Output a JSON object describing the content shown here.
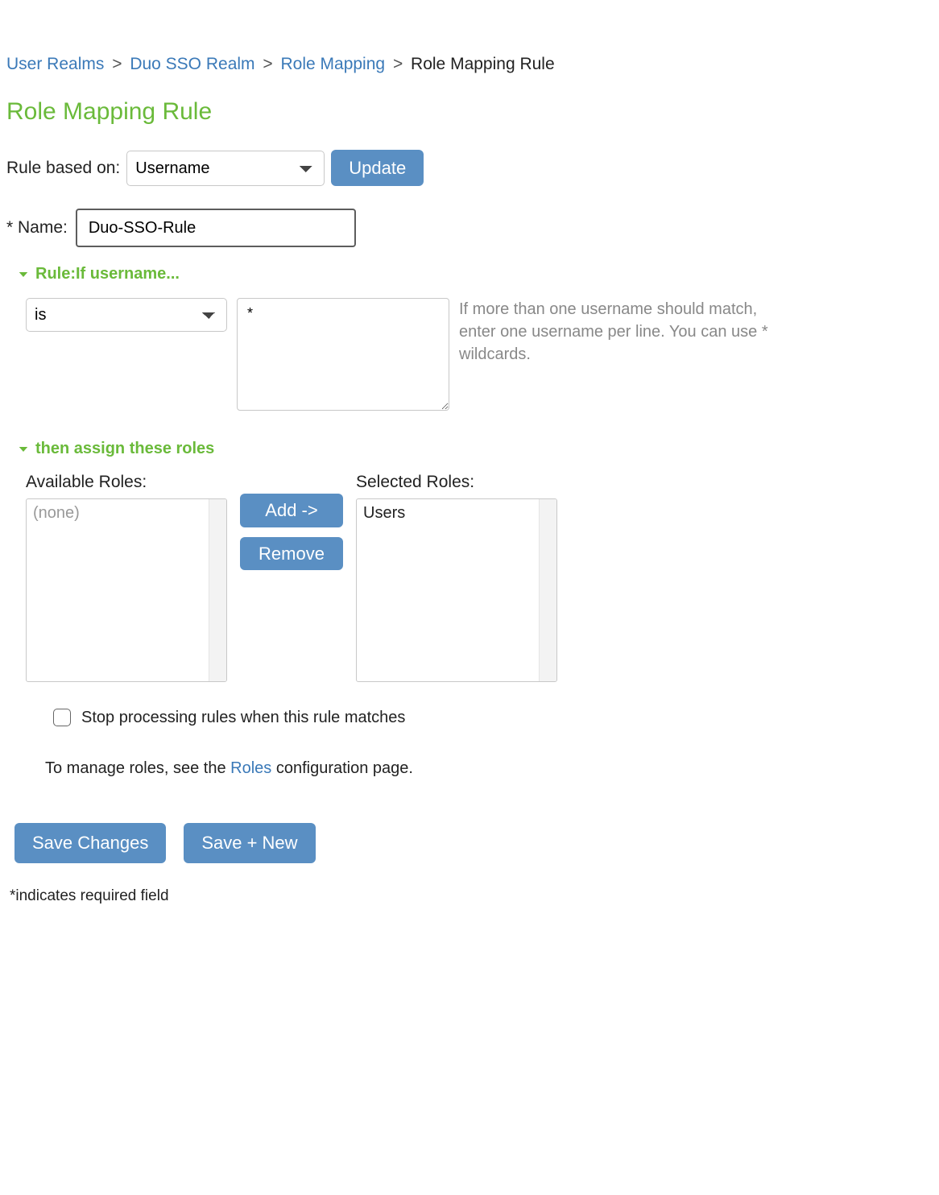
{
  "breadcrumb": {
    "items": [
      {
        "label": "User Realms",
        "link": true
      },
      {
        "label": "Duo SSO Realm",
        "link": true
      },
      {
        "label": "Role Mapping",
        "link": true
      },
      {
        "label": "Role Mapping Rule",
        "link": false
      }
    ],
    "sep": ">"
  },
  "page_title": "Role Mapping Rule",
  "rule_basis": {
    "label": "Rule based on:",
    "selected": "Username",
    "update_button": "Update"
  },
  "name_field": {
    "label": "* Name:",
    "value": "Duo-SSO-Rule"
  },
  "sections": {
    "rule": {
      "header": "Rule:If username...",
      "condition_selected": "is",
      "value": "*",
      "hint": "If more than one username should match, enter one username per line. You can use * wildcards."
    },
    "assign": {
      "header": "then assign these roles",
      "available_label": "Available Roles:",
      "selected_label": "Selected Roles:",
      "available_placeholder": "(none)",
      "selected_items": [
        "Users"
      ],
      "add_button": "Add ->",
      "remove_button": "Remove"
    }
  },
  "stop_checkbox": {
    "checked": false,
    "label": "Stop processing rules when this rule matches"
  },
  "manage_roles": {
    "prefix": "To manage roles, see the ",
    "link": "Roles",
    "suffix": " configuration page."
  },
  "buttons": {
    "save": "Save Changes",
    "save_new": "Save + New"
  },
  "required_note": "*indicates required field"
}
